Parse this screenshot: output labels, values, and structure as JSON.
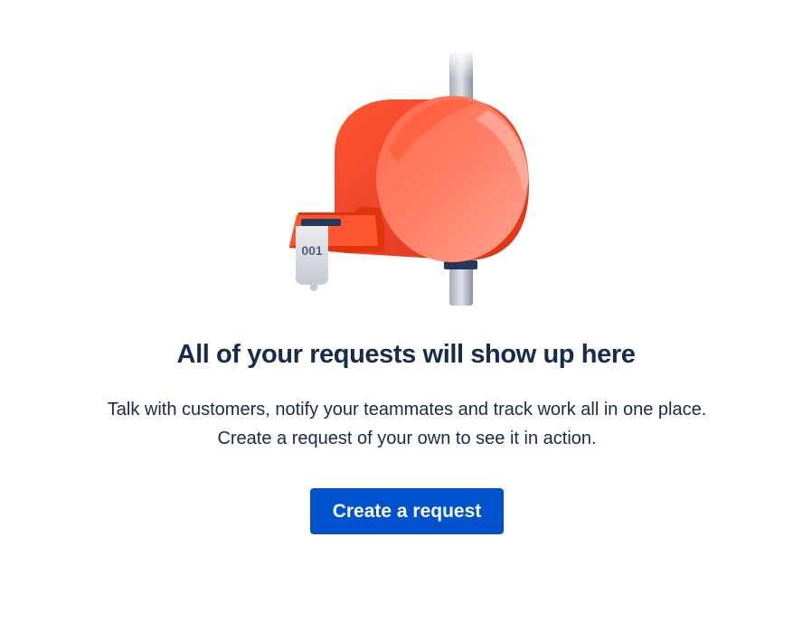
{
  "empty_state": {
    "illustration_name": "mailbox-illustration",
    "ticket_label": "001",
    "title": "All of your requests will show up here",
    "description": "Talk with customers, notify your teammates and track work all in one place. Create a request of your own to see it in action.",
    "cta_label": "Create a request"
  },
  "colors": {
    "accent": "#0052CC",
    "text": "#172B4D",
    "mailbox_red": "#FF5630",
    "post_gray": "#6B778C"
  }
}
